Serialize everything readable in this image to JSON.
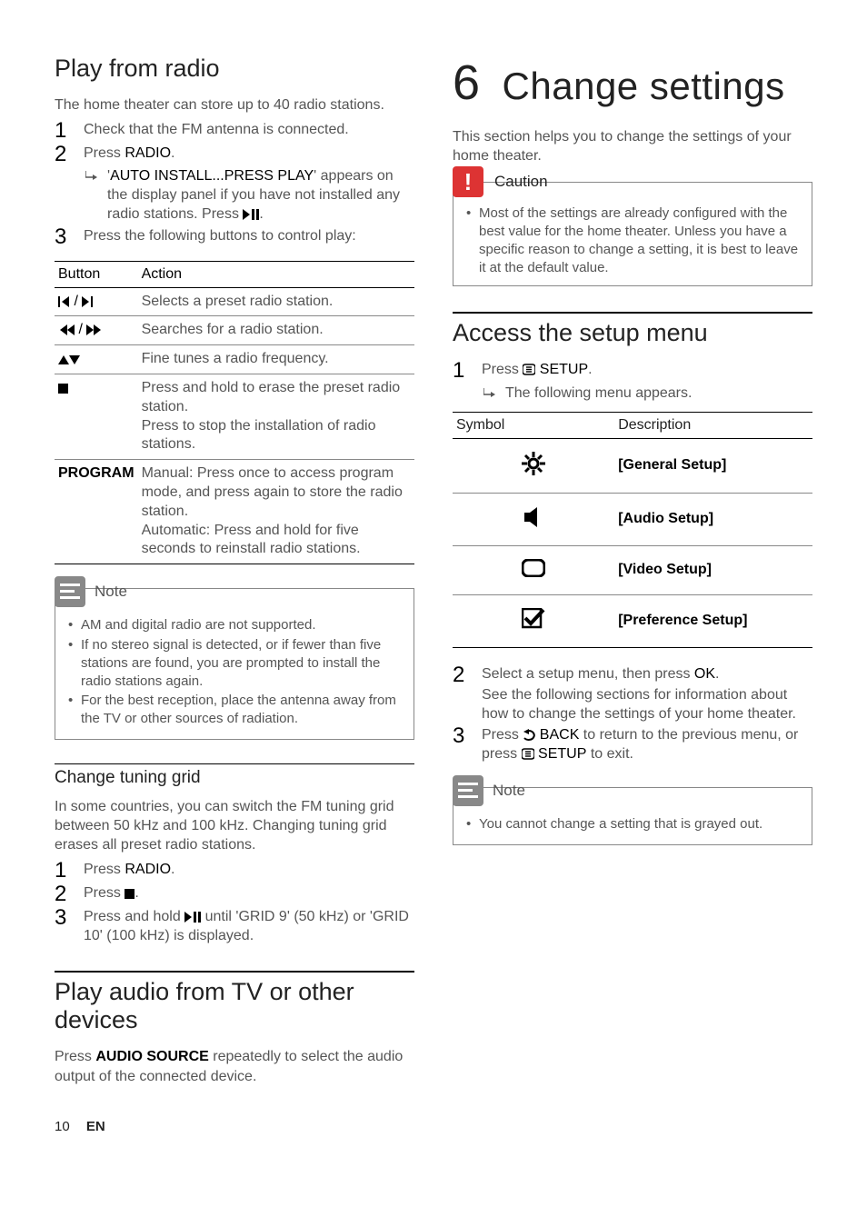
{
  "left": {
    "section1": {
      "title": "Play from radio",
      "intro": "The home theater can store up to 40 radio stations.",
      "steps": {
        "s1": {
          "n": "1",
          "text_a": "Check that the FM antenna is connected."
        },
        "s2": {
          "n": "2",
          "text_a": "Press ",
          "text_b": "RADIO",
          "text_c": ".",
          "sub_a": "'",
          "sub_b": "AUTO INSTALL...PRESS PLAY",
          "sub_c": "' appears on the display panel if you have not installed any radio stations. Press ",
          "sub_d": "."
        },
        "s3": {
          "n": "3",
          "text_a": "Press the following buttons to control play:"
        }
      },
      "table": {
        "h1": "Button",
        "h2": "Action",
        "rows": [
          {
            "action": "Selects a preset radio station."
          },
          {
            "action": "Searches for a radio station."
          },
          {
            "action": "Fine tunes a radio frequency."
          },
          {
            "action": "Press and hold to erase the preset radio station.\nPress to stop the installation of radio stations."
          },
          {
            "button": "PROGRAM",
            "action": "Manual: Press once to access program mode, and press again to store the radio station.\nAutomatic: Press and hold for five seconds to reinstall radio stations."
          }
        ]
      },
      "note": {
        "label": "Note",
        "items": [
          "AM and digital radio are not supported.",
          "If no stereo signal is detected, or if fewer than five stations are found, you are prompted to install the radio stations again.",
          "For the best reception, place the antenna away from the TV or other sources of radiation."
        ]
      },
      "tuning": {
        "title": "Change tuning grid",
        "intro": "In some countries, you can switch the FM tuning grid between 50 kHz and 100 kHz. Changing tuning grid erases all preset radio stations.",
        "s1": {
          "n": "1",
          "a": "Press ",
          "b": "RADIO",
          "c": "."
        },
        "s2": {
          "n": "2",
          "a": "Press ",
          "c": "."
        },
        "s3": {
          "n": "3",
          "a": "Press and hold ",
          "c": " until 'GRID 9' (50 kHz) or 'GRID 10' (100 kHz) is displayed."
        }
      }
    },
    "section2": {
      "title": "Play audio from TV or other devices",
      "p_a": "Press ",
      "p_b": "AUDIO SOURCE",
      "p_c": " repeatedly to select the audio output of the connected device."
    }
  },
  "right": {
    "chapter": {
      "num": "6",
      "title": "Change settings"
    },
    "intro": "This section helps you to change the settings of your home theater.",
    "caution": {
      "label": "Caution",
      "item": "Most of the settings are already configured with the best value for the home theater. Unless you have a specific reason to change a setting, it is best to leave it at the default value."
    },
    "access": {
      "title": "Access the setup menu",
      "s1": {
        "n": "1",
        "a": "Press ",
        "b": " SETUP",
        "c": ".",
        "sub": "The following menu appears."
      },
      "table": {
        "h1": "Symbol",
        "h2": "Description",
        "rows": [
          {
            "desc": "[General Setup]"
          },
          {
            "desc": "[Audio Setup]"
          },
          {
            "desc": "[Video Setup]"
          },
          {
            "desc": "[Preference Setup]"
          }
        ]
      },
      "s2": {
        "n": "2",
        "a": "Select a setup menu, then press ",
        "b": "OK",
        "c": ".",
        "d": "See the following sections for information about how to change the settings of your home theater."
      },
      "s3": {
        "n": "3",
        "a": "Press ",
        "b": " BACK",
        "c": " to return to the previous menu, or press ",
        "d": " SETUP",
        "e": " to exit."
      }
    },
    "note": {
      "label": "Note",
      "item": "You cannot change a setting that is grayed out."
    }
  },
  "footer": {
    "page": "10",
    "lang": "EN"
  }
}
